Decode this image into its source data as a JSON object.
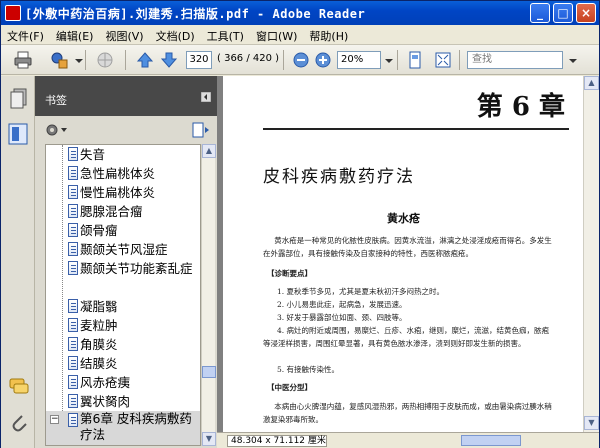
{
  "window": {
    "title": "[外敷中药治百病].刘建秀.扫描版.pdf - Adobe Reader",
    "min_label": "_",
    "max_label": "□",
    "close_label": "×"
  },
  "menu": [
    "文件(F)",
    "编辑(E)",
    "视图(V)",
    "文档(D)",
    "工具(T)",
    "窗口(W)",
    "帮助(H)"
  ],
  "toolbar": {
    "current_page": "320",
    "page_count": "( 366 / 420 )",
    "zoom": "20%",
    "search_placeholder": "查找"
  },
  "bookmarks": {
    "title": "书签",
    "items": [
      "失音",
      "急性扁桃体炎",
      "慢性扁桃体炎",
      "腮腺混合瘤",
      "颌骨瘤",
      "颞颌关节风湿症",
      "颞颌关节功能紊乱症",
      "凝脂翳",
      "麦粒肿",
      "角膜炎",
      "结膜炎",
      "风赤疮痍",
      "翼状胬肉"
    ],
    "chapter": "第6章 皮科疾病敷药疗法"
  },
  "document": {
    "chapter_heading": "第 6 章",
    "section_heading": "皮科疾病敷药疗法",
    "disease_title": "黄水疮",
    "intro": "黄水疮是一种常见的化脓性皮肤病。因黄水流溢，淋漓之处浸淫成疮而得名。多发生在外露部位，具有接触传染及自家接种的特性，西医称脓疱疮。",
    "diag_head": "【诊断要点】",
    "diag_points": [
      "1. 夏秋季节多见，尤其是夏末秋初汗多闷热之时。",
      "2. 小儿易患此症，起病急，发展迅速。",
      "3. 好发于暴露部位如面、颈、四肢等。",
      "4. 病灶的附近或周围，易糜烂、丘疹、水疱，继则，糜烂，流滋，结黄色痂，脓疱等浸淫样损害，周围红晕显著，具有黄色脓水渗泽，溃到则好即发生新的损害。",
      "5. 有接触传染性。"
    ],
    "type_head": "【中医分型】",
    "type_text": "本病由心火脾湿内蕴，复感风湿热邪，两热相搏阻于皮肤而成，或由暑染病过腠水稍激复染邪毒所致。"
  },
  "status": {
    "dimensions": "48.304 x 71.112 厘米"
  }
}
